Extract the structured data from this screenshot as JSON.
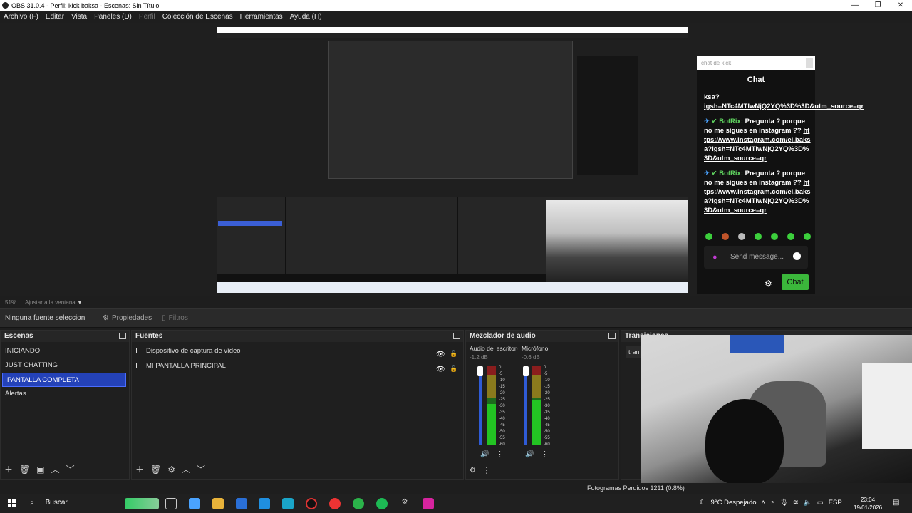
{
  "window": {
    "title": "OBS 31.0.4 - Perfil: kick baksa - Escenas: Sin Título"
  },
  "menu": {
    "items": [
      {
        "label": "Archivo (F)",
        "disabled": false
      },
      {
        "label": "Editar",
        "disabled": false
      },
      {
        "label": "Vista",
        "disabled": false
      },
      {
        "label": "Paneles (D)",
        "disabled": false
      },
      {
        "label": "Perfil",
        "disabled": true
      },
      {
        "label": "Colección de Escenas",
        "disabled": false
      },
      {
        "label": "Herramientas",
        "disabled": false
      },
      {
        "label": "Ayuda (H)",
        "disabled": false
      }
    ]
  },
  "chat": {
    "header_placeholder": "chat de kick",
    "title": "Chat",
    "partial_link": "ksa?igsh=NTc4MTIwNjQ2YQ%3D%3D&utm_source=qr",
    "messages": [
      {
        "user": "BotRix:",
        "text": "Pregunta ? porque no me sigues en instagram ?? ",
        "link": "https://www.instagram.com/el.baksa?igsh=NTc4MTIwNjQ2YQ%3D%3D&utm_source=qr"
      },
      {
        "user": "BotRix:",
        "text": "Pregunta ? porque no me sigues en instagram ?? ",
        "link": "https://www.instagram.com/el.baksa?igsh=NTc4MTIwNjQ2YQ%3D%3D&utm_source=qr"
      }
    ],
    "input_placeholder": "Send message...",
    "send_label": "Chat"
  },
  "zoom": {
    "value": "51%",
    "fit_label": "Ajustar a la ventana"
  },
  "props_bar": {
    "no_source": "Ninguna fuente seleccionada",
    "properties": "Propiedades",
    "filters": "Filtros"
  },
  "scenes": {
    "title": "Escenas",
    "items": [
      {
        "label": "INICIANDO",
        "selected": false
      },
      {
        "label": "JUST CHATTING",
        "selected": false
      },
      {
        "label": "PANTALLA COMPLETA",
        "selected": true
      },
      {
        "label": "Alertas",
        "selected": false
      }
    ]
  },
  "sources": {
    "title": "Fuentes",
    "items": [
      {
        "label": "Dispositivo de captura de vídeo"
      },
      {
        "label": "MI PANTALLA PRINCIPAL"
      }
    ]
  },
  "mixer": {
    "title": "Mezclador de audio",
    "channels": [
      {
        "name": "Audio del escritorio",
        "db": "-1.2 dB",
        "level": 0.52,
        "volume": 1.0
      },
      {
        "name": "Micrófono",
        "db": "-0.6 dB",
        "level": 0.56,
        "volume": 1.0
      }
    ],
    "scale": [
      "0",
      "-5",
      "-10",
      "-15",
      "-20",
      "-25",
      "-30",
      "-35",
      "-40",
      "-45",
      "-50",
      "-55",
      "-60"
    ]
  },
  "transitions": {
    "title": "Transiciones",
    "partial": "tran"
  },
  "status": {
    "dropped": "Fotogramas Perdidos 1211 (0.8%)"
  },
  "taskbar": {
    "search": "Buscar",
    "weather": "9°C  Despejado",
    "lang": "ESP",
    "time": "23:04",
    "date": "19/01/2026"
  },
  "colors": {
    "accent": "#2442b8",
    "chat_green": "#3bb73b",
    "botrix_green": "#5fd35f"
  }
}
